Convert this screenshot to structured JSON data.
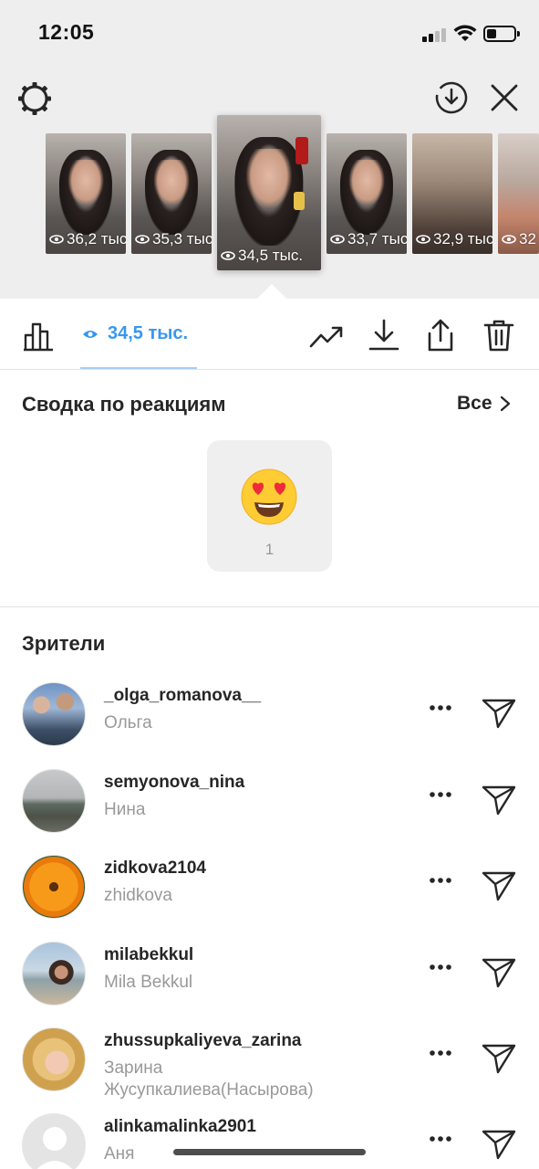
{
  "status_bar": {
    "time": "12:05"
  },
  "stories": [
    {
      "views": "36,2 тыс."
    },
    {
      "views": "35,3 тыс."
    },
    {
      "views": "34,5 тыс."
    },
    {
      "views": "33,7 тыс."
    },
    {
      "views": "32,9 тыс."
    },
    {
      "views": "32"
    }
  ],
  "toolbar": {
    "views_count": "34,5 тыс.",
    "accent_color": "#3897f0"
  },
  "reactions": {
    "title": "Сводка по реакциям",
    "see_all": "Все",
    "items": [
      {
        "emoji": "heart-eyes-emoji",
        "count": "1"
      }
    ]
  },
  "viewers": {
    "title": "Зрители",
    "list": [
      {
        "username": "_olga_romanova__",
        "name": "Ольга"
      },
      {
        "username": "semyonova_nina",
        "name": "Нина"
      },
      {
        "username": "zidkova2104",
        "name": "zhidkova"
      },
      {
        "username": "milabekkul",
        "name": "Mila Bekkul"
      },
      {
        "username": "zhussupkaliyeva_zarina",
        "name": "Зарина Жусупкалиева(Насырова)"
      },
      {
        "username": "alinkamalinka2901",
        "name": "Аня"
      }
    ]
  }
}
